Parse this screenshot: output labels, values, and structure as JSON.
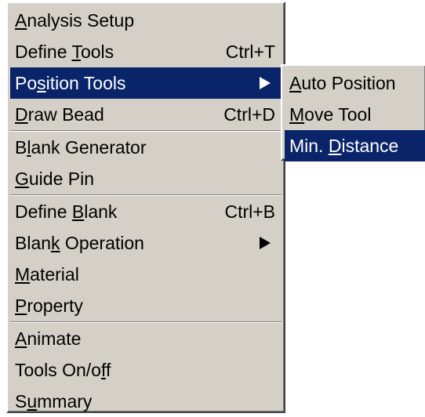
{
  "main_menu": {
    "items": [
      {
        "pre": "",
        "acc": "A",
        "post": "nalysis Setup",
        "shortcut": ""
      },
      {
        "pre": "Define ",
        "acc": "T",
        "post": "ools",
        "shortcut": "Ctrl+T"
      },
      {
        "pre": "Po",
        "acc": "s",
        "post": "ition Tools",
        "shortcut": ""
      },
      {
        "pre": "",
        "acc": "D",
        "post": "raw Bead",
        "shortcut": "Ctrl+D"
      },
      {
        "pre": "B",
        "acc": "l",
        "post": "ank Generator",
        "shortcut": ""
      },
      {
        "pre": "",
        "acc": "G",
        "post": "uide Pin",
        "shortcut": ""
      },
      {
        "pre": "Define ",
        "acc": "B",
        "post": "lank",
        "shortcut": "Ctrl+B"
      },
      {
        "pre": "Blan",
        "acc": "k",
        "post": " Operation",
        "shortcut": ""
      },
      {
        "pre": "",
        "acc": "M",
        "post": "aterial",
        "shortcut": ""
      },
      {
        "pre": "",
        "acc": "P",
        "post": "roperty",
        "shortcut": ""
      },
      {
        "pre": "",
        "acc": "A",
        "post": "nimate",
        "shortcut": ""
      },
      {
        "pre": "Tools On/o",
        "acc": "f",
        "post": "f",
        "shortcut": ""
      },
      {
        "pre": "S",
        "acc": "u",
        "post": "mmary",
        "shortcut": ""
      }
    ]
  },
  "sub_menu": {
    "items": [
      {
        "pre": "",
        "acc": "A",
        "post": "uto Position"
      },
      {
        "pre": "",
        "acc": "M",
        "post": "ove Tool"
      },
      {
        "pre": "Min. ",
        "acc": "D",
        "post": "istance"
      }
    ]
  },
  "colors": {
    "menu_bg": "#d4d0c8",
    "highlight": "#0a246a",
    "highlight_text": "#ffffff"
  }
}
